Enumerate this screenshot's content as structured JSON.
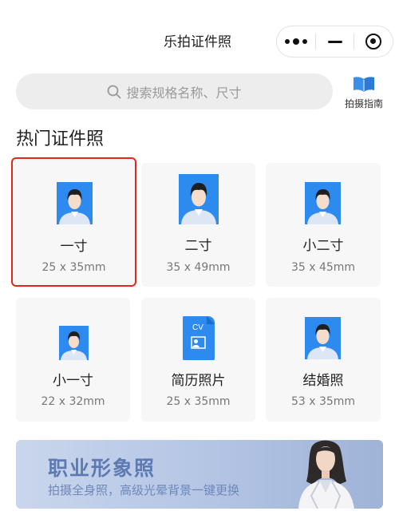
{
  "header": {
    "title": "乐拍证件照"
  },
  "search": {
    "placeholder": "搜索规格名称、尺寸"
  },
  "guide": {
    "label": "拍摄指南"
  },
  "section": {
    "title": "热门证件照"
  },
  "cards": [
    {
      "name": "一寸",
      "size": "25 x 35mm",
      "selected": true
    },
    {
      "name": "二寸",
      "size": "35 x 49mm"
    },
    {
      "name": "小二寸",
      "size": "35 x 45mm"
    },
    {
      "name": "小一寸",
      "size": "22 x 32mm"
    },
    {
      "name": "简历照片",
      "size": "25 x 35mm",
      "badge": "CV"
    },
    {
      "name": "结婚照",
      "size": "53 x 35mm"
    }
  ],
  "banner": {
    "title": "职业形象照",
    "subtitle": "拍摄全身照，高级光晕背景一键更换"
  },
  "colors": {
    "photo_bg": "#2d8bf0",
    "selected_border": "#e0291e",
    "banner_text": "#5d7ab2"
  }
}
